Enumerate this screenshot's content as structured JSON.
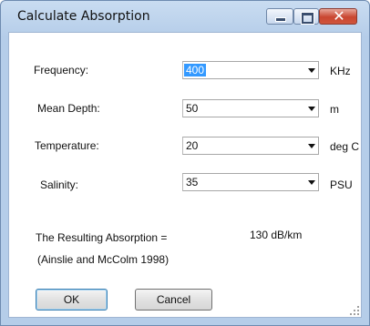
{
  "window": {
    "title": "Calculate Absorption"
  },
  "fields": [
    {
      "label": "Frequency:",
      "value": "400",
      "unit": "KHz",
      "selected": true
    },
    {
      "label": "Mean Depth:",
      "value": "50",
      "unit": "m",
      "selected": false
    },
    {
      "label": "Temperature:",
      "value": "20",
      "unit": "deg C",
      "selected": false
    },
    {
      "label": "Salinity:",
      "value": "35",
      "unit": "PSU",
      "selected": false
    }
  ],
  "result": {
    "label": "The Resulting Absorption =",
    "value": "130 dB/km",
    "reference": "(Ainslie and McColm 1998)"
  },
  "buttons": {
    "ok": "OK",
    "cancel": "Cancel"
  },
  "icons": [
    "minimize-icon",
    "maximize-icon",
    "close-icon",
    "dropdown-arrow-icon",
    "resize-grip-icon"
  ]
}
